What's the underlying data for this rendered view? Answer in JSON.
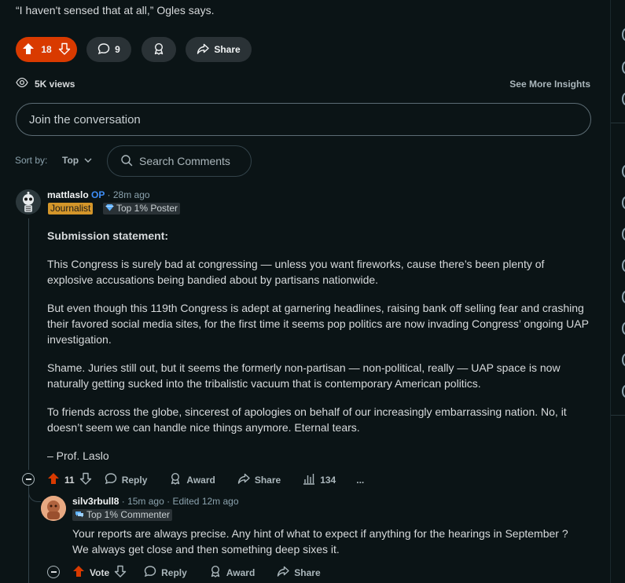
{
  "post": {
    "quote": "“I haven't sensed that at all,” Ogles says.",
    "vote_count": "18",
    "comment_count": "9",
    "share_label": "Share",
    "views": "5K views",
    "insights_label": "See More Insights"
  },
  "composer": {
    "placeholder": "Join the conversation"
  },
  "sort": {
    "label": "Sort by:",
    "value": "Top"
  },
  "search": {
    "placeholder": "Search Comments"
  },
  "comments": [
    {
      "author": "mattlaslo",
      "op_badge": "OP",
      "time": "28m ago",
      "flair": "Journalist",
      "badge": "Top 1% Poster",
      "heading": "Submission statement:",
      "paragraphs": [
        "This Congress is surely bad at congressing — unless you want fireworks, cause there’s been plenty of explosive accusations being bandied about by partisans nationwide.",
        "But even though this 119th Congress is adept at garnering headlines, raising bank off selling fear and crashing their favored social media sites, for the first time it seems pop politics are now invading Congress’ ongoing UAP investigation.",
        "Shame. Juries still out, but it seems the formerly non-partisan — non-political, really — UAP space is now naturally getting sucked into the tribalistic vacuum that is contemporary American politics.",
        "To friends across the globe, sincerest of apologies on behalf of our increasingly embarrassing nation. No, it doesn’t seem we can handle nice things anymore. Eternal tears.",
        "– Prof. Laslo"
      ],
      "votes": "11",
      "reply_label": "Reply",
      "award_label": "Award",
      "share_label": "Share",
      "insights_count": "134",
      "more_label": "..."
    },
    {
      "author": "silv3rbull8",
      "time": "15m ago",
      "edited": "Edited 12m ago",
      "badge": "Top 1% Commenter",
      "text": "Your reports are always precise. Any hint of what to expect if anything for the hearings in September ? We always get close and then something deep sixes it.",
      "votes": "Vote",
      "reply_label": "Reply",
      "award_label": "Award",
      "share_label": "Share"
    }
  ],
  "colors": {
    "upvote": "#d93a00",
    "op": "#3e8ef7",
    "journalist_flair": "#d4962a",
    "background": "#0b1416"
  }
}
